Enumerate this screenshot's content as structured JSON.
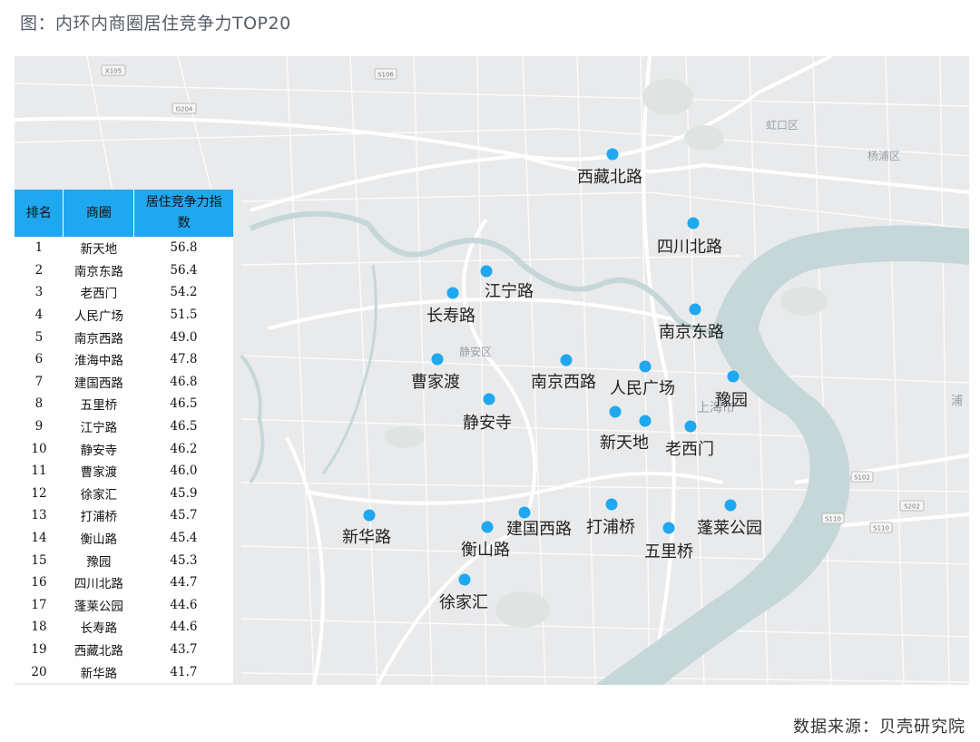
{
  "caption": "图：内环内商圈居住竞争力TOP20",
  "source": "数据来源：贝壳研究院",
  "colors": {
    "accent": "#1fa7ef",
    "marker": "#1fa7ef",
    "river": "#c5d7d8",
    "land": "#e9eaec"
  },
  "table": {
    "headers": [
      "排名",
      "商圈",
      "居住竞争力指数"
    ],
    "rows": [
      {
        "rank": "1",
        "area": "新天地",
        "score": "56.8"
      },
      {
        "rank": "2",
        "area": "南京东路",
        "score": "56.4"
      },
      {
        "rank": "3",
        "area": "老西门",
        "score": "54.2"
      },
      {
        "rank": "4",
        "area": "人民广场",
        "score": "51.5"
      },
      {
        "rank": "5",
        "area": "南京西路",
        "score": "49.0"
      },
      {
        "rank": "6",
        "area": "淮海中路",
        "score": "47.8"
      },
      {
        "rank": "7",
        "area": "建国西路",
        "score": "46.8"
      },
      {
        "rank": "8",
        "area": "五里桥",
        "score": "46.5"
      },
      {
        "rank": "9",
        "area": "江宁路",
        "score": "46.5"
      },
      {
        "rank": "10",
        "area": "静安寺",
        "score": "46.2"
      },
      {
        "rank": "11",
        "area": "曹家渡",
        "score": "46.0"
      },
      {
        "rank": "12",
        "area": "徐家汇",
        "score": "45.9"
      },
      {
        "rank": "13",
        "area": "打浦桥",
        "score": "45.7"
      },
      {
        "rank": "14",
        "area": "衡山路",
        "score": "45.4"
      },
      {
        "rank": "15",
        "area": "豫园",
        "score": "45.3"
      },
      {
        "rank": "16",
        "area": "四川北路",
        "score": "44.7"
      },
      {
        "rank": "17",
        "area": "蓬莱公园",
        "score": "44.6"
      },
      {
        "rank": "18",
        "area": "长寿路",
        "score": "44.6"
      },
      {
        "rank": "19",
        "area": "西藏北路",
        "score": "43.7"
      },
      {
        "rank": "20",
        "area": "新华路",
        "score": "41.7"
      }
    ]
  },
  "map": {
    "district_labels": [
      "虹口区",
      "杨浦区",
      "静安区",
      "上海市",
      "浦"
    ],
    "road_shields": [
      "X105",
      "S106",
      "G204",
      "S102",
      "S202",
      "S110",
      "S110"
    ]
  }
}
